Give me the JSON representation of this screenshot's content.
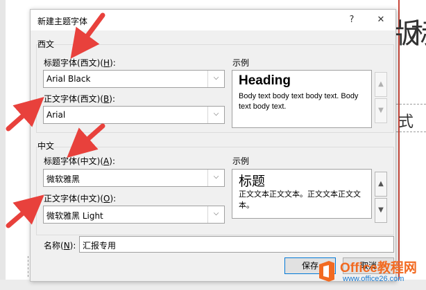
{
  "background": {
    "chars": [
      "版",
      "标",
      "式"
    ]
  },
  "dialog": {
    "title": "新建主题字体",
    "help_glyph": "?",
    "close_glyph": "✕",
    "western": {
      "group_label": "西文",
      "heading_label_text": "标题字体(西文)(",
      "heading_label_key": "H",
      "heading_label_end": "):",
      "heading_font": "Arial Black",
      "body_label_text": "正文字体(西文)(",
      "body_label_key": "B",
      "body_label_end": "):",
      "body_font": "Arial",
      "sample_label": "示例",
      "sample_heading": "Heading",
      "sample_body": "Body text body text body text. Body text body text."
    },
    "asian": {
      "group_label": "中文",
      "heading_label_text": "标题字体(中文)(",
      "heading_label_key": "A",
      "heading_label_end": "):",
      "heading_font": "微软雅黑",
      "body_label_text": "正文字体(中文)(",
      "body_label_key": "O",
      "body_label_end": "):",
      "body_font": "微软雅黑 Light",
      "sample_label": "示例",
      "sample_heading": "标题",
      "sample_body": "正文文本正文文本。正文文本正文文本。"
    },
    "name_label_text": "名称(",
    "name_label_key": "N",
    "name_label_end": "):",
    "name_value": "汇报专用",
    "save_label": "保存",
    "cancel_label": "取消"
  },
  "watermark": {
    "brand": "Office教程网",
    "url": "www.office26.com"
  },
  "colors": {
    "annotation_arrow": "#e8413c",
    "watermark_orange": "#f26a21",
    "watermark_blue": "#1a7bd1"
  }
}
